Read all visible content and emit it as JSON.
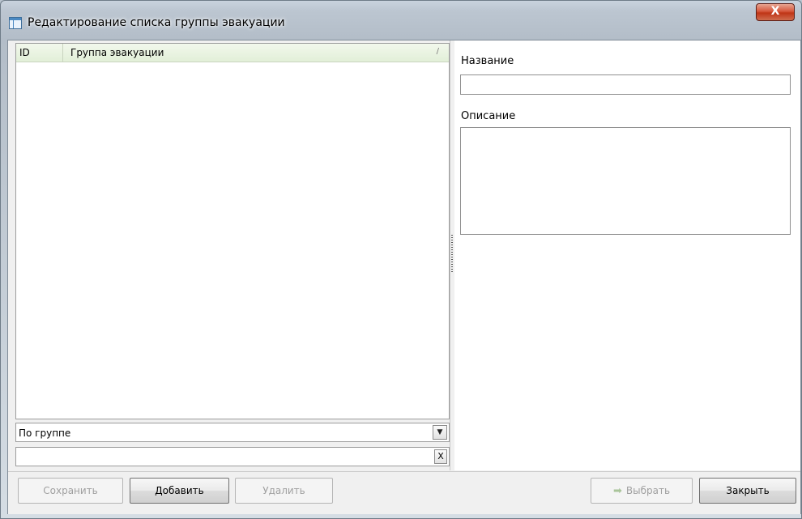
{
  "window": {
    "title": "Редактирование списка группы эвакуации",
    "close_label": "X"
  },
  "grid": {
    "columns": [
      "ID",
      "Группа эвакуации"
    ],
    "sort_indicator": "/",
    "rows": []
  },
  "filter": {
    "selected": "По группе",
    "search_value": "",
    "clear_label": "X"
  },
  "form": {
    "name_label": "Название",
    "name_value": "",
    "description_label": "Описание",
    "description_value": ""
  },
  "buttons": {
    "save": "Сохранить",
    "add": "Добавить",
    "delete": "Удалить",
    "select": "Выбрать",
    "close": "Закрыть"
  }
}
